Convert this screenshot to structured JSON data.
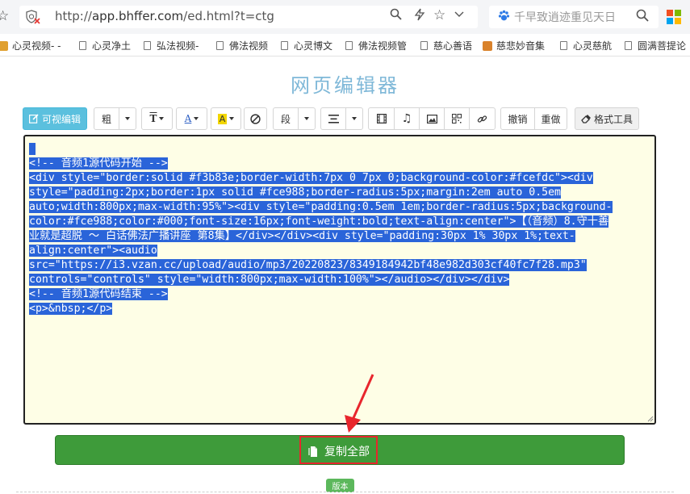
{
  "browser": {
    "url_scheme": "http://",
    "url_host": "app.bhffer.com",
    "url_path": "/ed.html?t=ctg",
    "search_placeholder": "千早致逍迹重见天日",
    "icons": {
      "security": "shield-blocked-icon",
      "search": "magnifier-icon",
      "speed": "lightning-icon",
      "favorite": "star-icon",
      "dropdown": "chevron-down-icon",
      "search_engine": "paw-icon",
      "apps": "apps-grid-icon"
    },
    "apps_colors": [
      "#f25022",
      "#7fba00",
      "#00a4ef",
      "#ffb900"
    ]
  },
  "bookmarks": [
    {
      "label": "心灵视频- -",
      "icon": "site-favicon"
    },
    {
      "label": "心灵净土",
      "icon": "document-icon"
    },
    {
      "label": "弘法视频-",
      "icon": "document-icon"
    },
    {
      "label": "佛法视频",
      "icon": "document-icon"
    },
    {
      "label": "心灵博文",
      "icon": "document-icon"
    },
    {
      "label": "佛法视频管",
      "icon": "document-icon"
    },
    {
      "label": "慈心善语",
      "icon": "document-icon"
    },
    {
      "label": "慈悲妙音集",
      "icon": "site-favicon"
    },
    {
      "label": "心灵慈航",
      "icon": "document-icon"
    },
    {
      "label": "圆满菩提论",
      "icon": "document-icon"
    }
  ],
  "page": {
    "title": "网页编辑器"
  },
  "toolbar": {
    "visual_edit": "可视编辑",
    "bold": "粗",
    "font_size": "T",
    "font_color": "A",
    "bg_color": "A",
    "clear_icon": "no-format-icon",
    "paragraph": "段",
    "align_icon": "align-center-icon",
    "video_icon": "film-icon",
    "audio_icon": "music-note-icon",
    "image_icon": "image-icon",
    "qrcode_icon": "qrcode-icon",
    "link_icon": "link-icon",
    "undo": "撤销",
    "redo": "重做",
    "format_tool": "格式工具",
    "accent": "#5bc0de"
  },
  "editor": {
    "selection_color": "#2a64d9",
    "background": "#fefee6",
    "lines": [
      "",
      "<!-- 音频1源代码开始 -->",
      "<div style=\"border:solid #f3b83e;border-width:7px 0 7px 0;background-color:#fcefdc\"><div",
      "style=\"padding:2px;border:1px solid #fce988;border-radius:5px;margin:2em auto 0.5em",
      "auto;width:800px;max-width:95%\"><div style=\"padding:0.5em 1em;border-radius:5px;background-",
      "color:#fce988;color:#000;font-size:16px;font-weight:bold;text-align:center\">【（音频）8.守十善",
      "业就是超脱 ～ 白话佛法广播讲座 第8集】</div></div><div style=\"padding:30px 1% 30px 1%;text-",
      "align:center\"><audio",
      "src=\"https://i3.vzan.cc/upload/audio/mp3/20220823/8349184942bf48e982d303cf40fc7f28.mp3\"",
      "controls=\"controls\" style=\"width:800px;max-width:100%\"></audio></div></div>",
      "<!-- 音频1源代码结束 -->",
      "<p>&nbsp;</p>"
    ]
  },
  "actions": {
    "copy_all": "复制全部",
    "copy_icon": "clipboard-icon",
    "copy_color": "#3e9b3a",
    "highlight_color": "#e8262d"
  },
  "footer": {
    "version": "版本"
  }
}
